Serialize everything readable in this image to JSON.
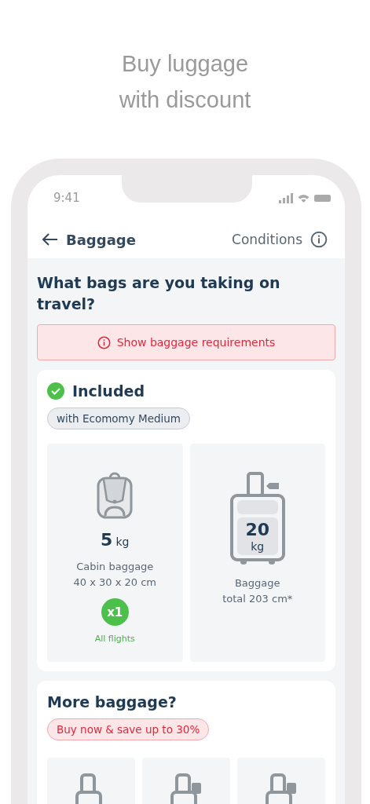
{
  "promo": {
    "title_lines": [
      "Buy luggage",
      "with discount"
    ]
  },
  "status_bar": {
    "time": "9:41"
  },
  "header": {
    "title": "Baggage",
    "link": "Conditions"
  },
  "question": "What bags are you taking on travel?",
  "requirements_button": "Show baggage requirements",
  "included": {
    "title": "Included",
    "tariff": "with Ecomomy Medium",
    "items": [
      {
        "kind": "backpack",
        "weight": "5",
        "unit": "kg",
        "name": "Cabin baggage",
        "size": "40 x 30 x 20 cm",
        "count": "x1",
        "note": "All flights"
      },
      {
        "kind": "suitcase",
        "weight": "20",
        "unit": "kg",
        "name": "Baggage",
        "size": "total 203 cm*"
      }
    ]
  },
  "more": {
    "title": "More baggage?",
    "promo": "Buy now & save up to 30%",
    "options": [
      {
        "kind": "plain"
      },
      {
        "kind": "tagged"
      },
      {
        "kind": "tagged"
      }
    ]
  }
}
